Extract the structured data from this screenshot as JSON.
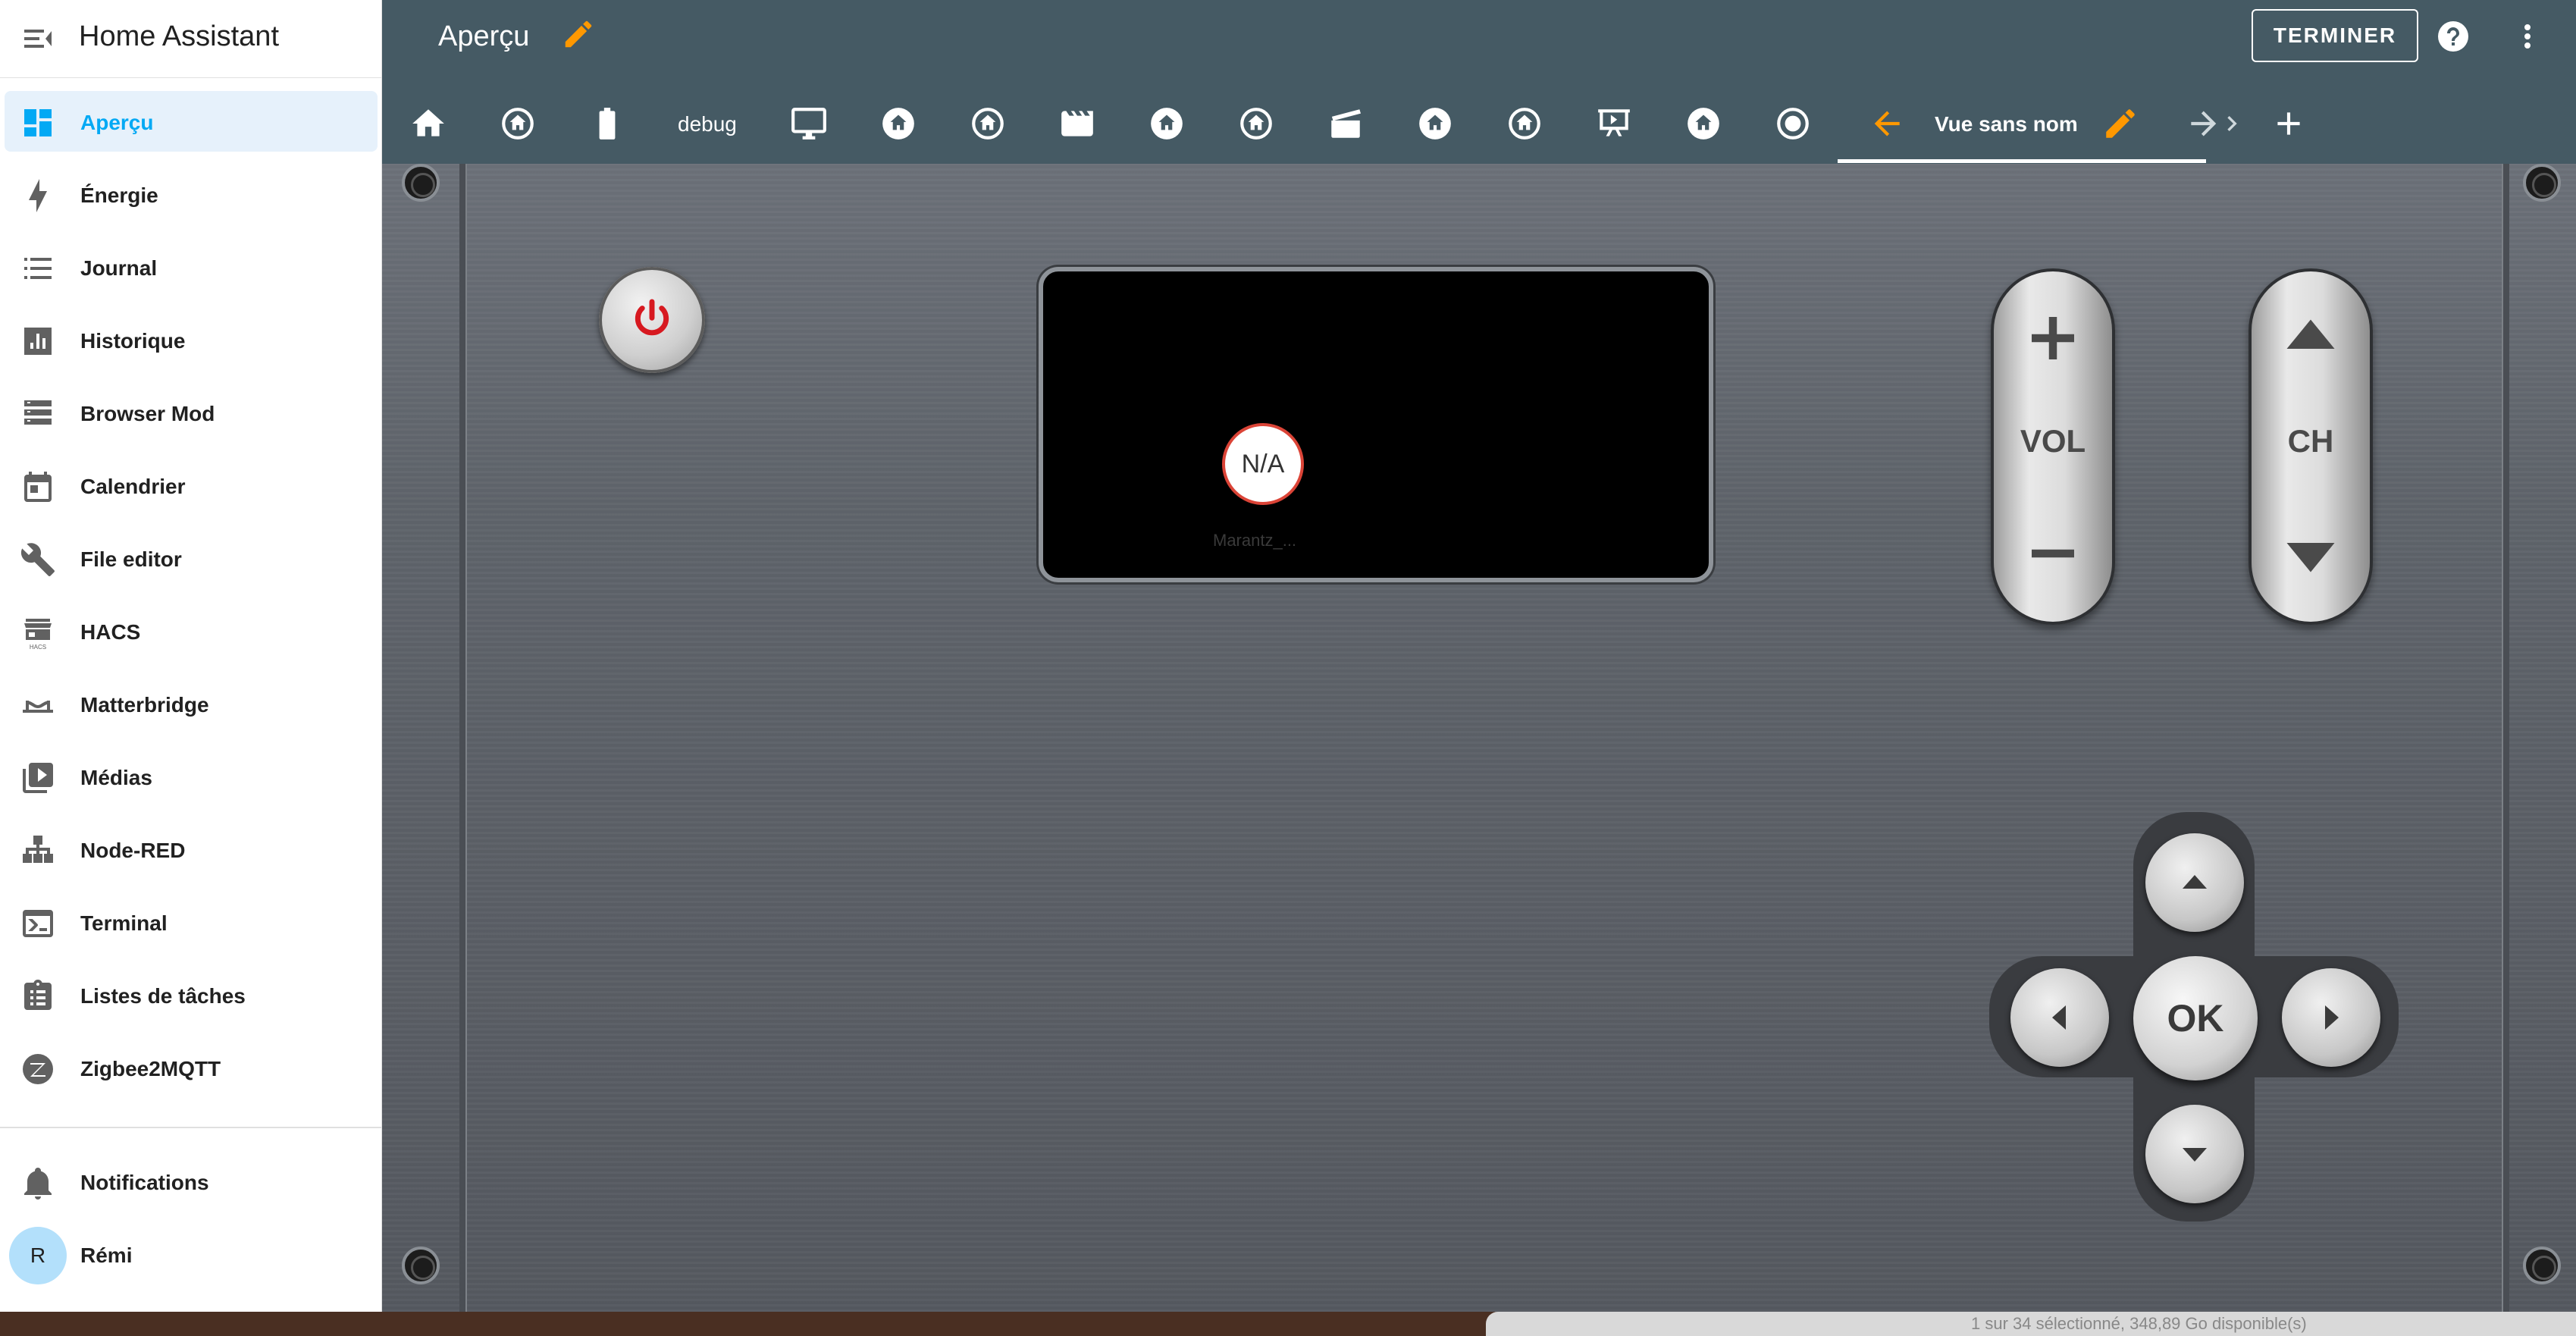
{
  "sidebar": {
    "title": "Home Assistant",
    "items": [
      {
        "label": "Aperçu",
        "icon": "dashboard-icon",
        "active": true
      },
      {
        "label": "Énergie",
        "icon": "lightning-icon"
      },
      {
        "label": "Journal",
        "icon": "list-icon"
      },
      {
        "label": "Historique",
        "icon": "chart-icon"
      },
      {
        "label": "Browser Mod",
        "icon": "server-icon"
      },
      {
        "label": "Calendrier",
        "icon": "calendar-icon"
      },
      {
        "label": "File editor",
        "icon": "wrench-icon"
      },
      {
        "label": "HACS",
        "icon": "hacs-icon"
      },
      {
        "label": "Matterbridge",
        "icon": "bridge-icon"
      },
      {
        "label": "Médias",
        "icon": "media-icon"
      },
      {
        "label": "Node-RED",
        "icon": "sitemap-icon"
      },
      {
        "label": "Terminal",
        "icon": "terminal-icon"
      },
      {
        "label": "Listes de tâches",
        "icon": "clipboard-icon"
      },
      {
        "label": "Zigbee2MQTT",
        "icon": "zigbee-icon"
      }
    ],
    "notifications_label": "Notifications",
    "user": {
      "name": "Rémi",
      "initial": "R"
    }
  },
  "toolbar": {
    "title": "Aperçu",
    "done_label": "TERMINER",
    "tabs": [
      {
        "icon": "home-icon"
      },
      {
        "icon": "home-circle-icon"
      },
      {
        "icon": "battery-icon"
      },
      {
        "label": "debug"
      },
      {
        "icon": "monitor-icon"
      },
      {
        "icon": "home-circle-icon"
      },
      {
        "icon": "home-circle-icon"
      },
      {
        "icon": "film-icon"
      },
      {
        "icon": "home-circle-icon"
      },
      {
        "icon": "home-circle-icon"
      },
      {
        "icon": "clapper-icon"
      },
      {
        "icon": "home-circle-icon"
      },
      {
        "icon": "home-circle-icon"
      },
      {
        "icon": "presentation-icon"
      },
      {
        "icon": "home-circle-icon"
      },
      {
        "icon": "record-icon"
      }
    ],
    "active_tab_label": "Vue sans nom",
    "accent": "#ff9800"
  },
  "remote": {
    "display_state": "N/A",
    "display_label": "Marantz_...",
    "vol_label": "VOL",
    "ch_label": "CH",
    "ok_label": "OK"
  },
  "footer": {
    "status_text": "1 sur 34 sélectionné, 348,89 Go disponible(s)"
  }
}
